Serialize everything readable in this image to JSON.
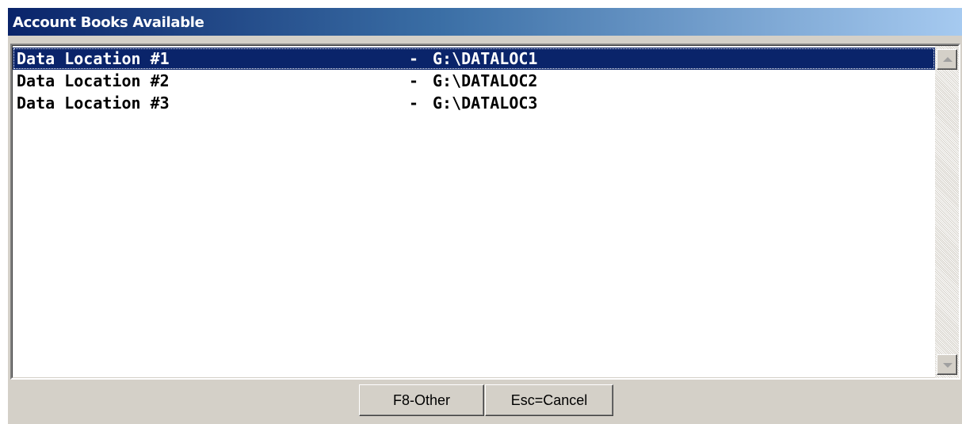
{
  "window": {
    "title": "Account Books Available"
  },
  "list": {
    "items": [
      {
        "name": "Data Location #1",
        "separator": "-",
        "path": "G:\\DATALOC1",
        "selected": true
      },
      {
        "name": "Data Location #2",
        "separator": "-",
        "path": "G:\\DATALOC2",
        "selected": false
      },
      {
        "name": "Data Location #3",
        "separator": "-",
        "path": "G:\\DATALOC3",
        "selected": false
      }
    ]
  },
  "buttons": {
    "other_label": "F8-Other",
    "cancel_label": "Esc=Cancel"
  },
  "colors": {
    "title_bar_start": "#0a246a",
    "title_bar_end": "#a6caf0",
    "selection": "#0a246a",
    "face": "#d4d0c8"
  },
  "icons": {
    "scroll_up": "triangle-up",
    "scroll_down": "triangle-down"
  }
}
